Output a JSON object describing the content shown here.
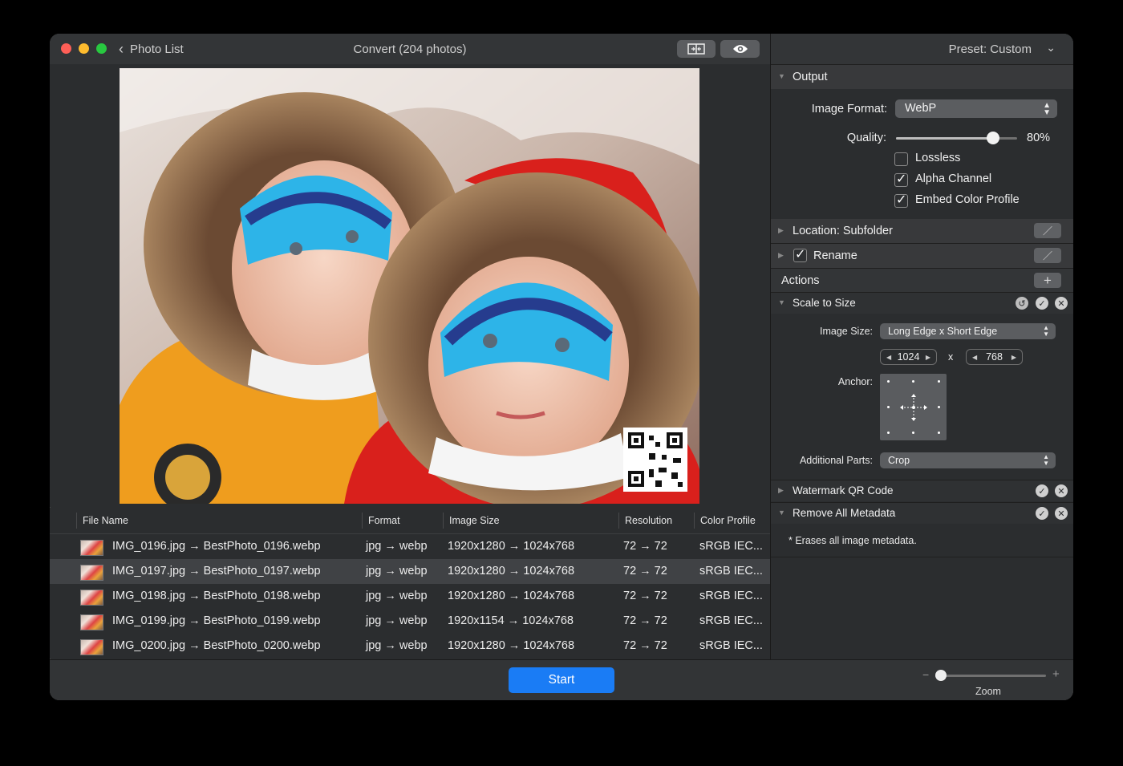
{
  "window": {
    "back_label": "Photo List",
    "title": "Convert (204 photos)",
    "toolbar_compare_icon": "compare-icon",
    "toolbar_preview_icon": "eye-icon"
  },
  "table": {
    "headers": [
      "File Name",
      "Format",
      "Image Size",
      "Resolution",
      "Color Profile"
    ],
    "rows": [
      {
        "name": "IMG_0196.jpg → BestPhoto_0196.webp",
        "format": "jpg → webp",
        "size": "1920x1280 → 1024x768",
        "res": "72 → 72",
        "profile": "sRGB IEC..."
      },
      {
        "name": "IMG_0197.jpg → BestPhoto_0197.webp",
        "format": "jpg → webp",
        "size": "1920x1280 → 1024x768",
        "res": "72 → 72",
        "profile": "sRGB IEC..."
      },
      {
        "name": "IMG_0198.jpg → BestPhoto_0198.webp",
        "format": "jpg → webp",
        "size": "1920x1280 → 1024x768",
        "res": "72 → 72",
        "profile": "sRGB IEC..."
      },
      {
        "name": "IMG_0199.jpg → BestPhoto_0199.webp",
        "format": "jpg → webp",
        "size": "1920x1154 → 1024x768",
        "res": "72 → 72",
        "profile": "sRGB IEC..."
      },
      {
        "name": "IMG_0200.jpg → BestPhoto_0200.webp",
        "format": "jpg → webp",
        "size": "1920x1280 → 1024x768",
        "res": "72 → 72",
        "profile": "sRGB IEC..."
      }
    ],
    "selected_row": 1
  },
  "bottom": {
    "start_label": "Start",
    "zoom_minus": "−",
    "zoom_plus": "+",
    "zoom_label": "Zoom",
    "zoom_level": 0.05
  },
  "panel": {
    "preset_label": "Preset: Custom",
    "output": {
      "header": "Output",
      "format_label": "Image Format:",
      "format_value": "WebP",
      "quality_label": "Quality:",
      "quality_value": "80%",
      "quality_level": 0.8,
      "lossless_label": "Lossless",
      "lossless_checked": false,
      "alpha_label": "Alpha Channel",
      "alpha_checked": true,
      "embed_label": "Embed Color Profile",
      "embed_checked": true
    },
    "location_label": "Location: Subfolder",
    "rename_label": "Rename",
    "actions_label": "Actions",
    "scale": {
      "header": "Scale to Size",
      "image_size_label": "Image Size:",
      "image_size_value": "Long Edge x Short Edge",
      "width_value": "1024",
      "times": "x",
      "height_value": "768",
      "anchor_label": "Anchor:",
      "additional_label": "Additional Parts:",
      "additional_value": "Crop"
    },
    "watermark_label": "Watermark QR Code",
    "metadata_label": "Remove All Metadata",
    "metadata_note": "* Erases all image metadata."
  }
}
